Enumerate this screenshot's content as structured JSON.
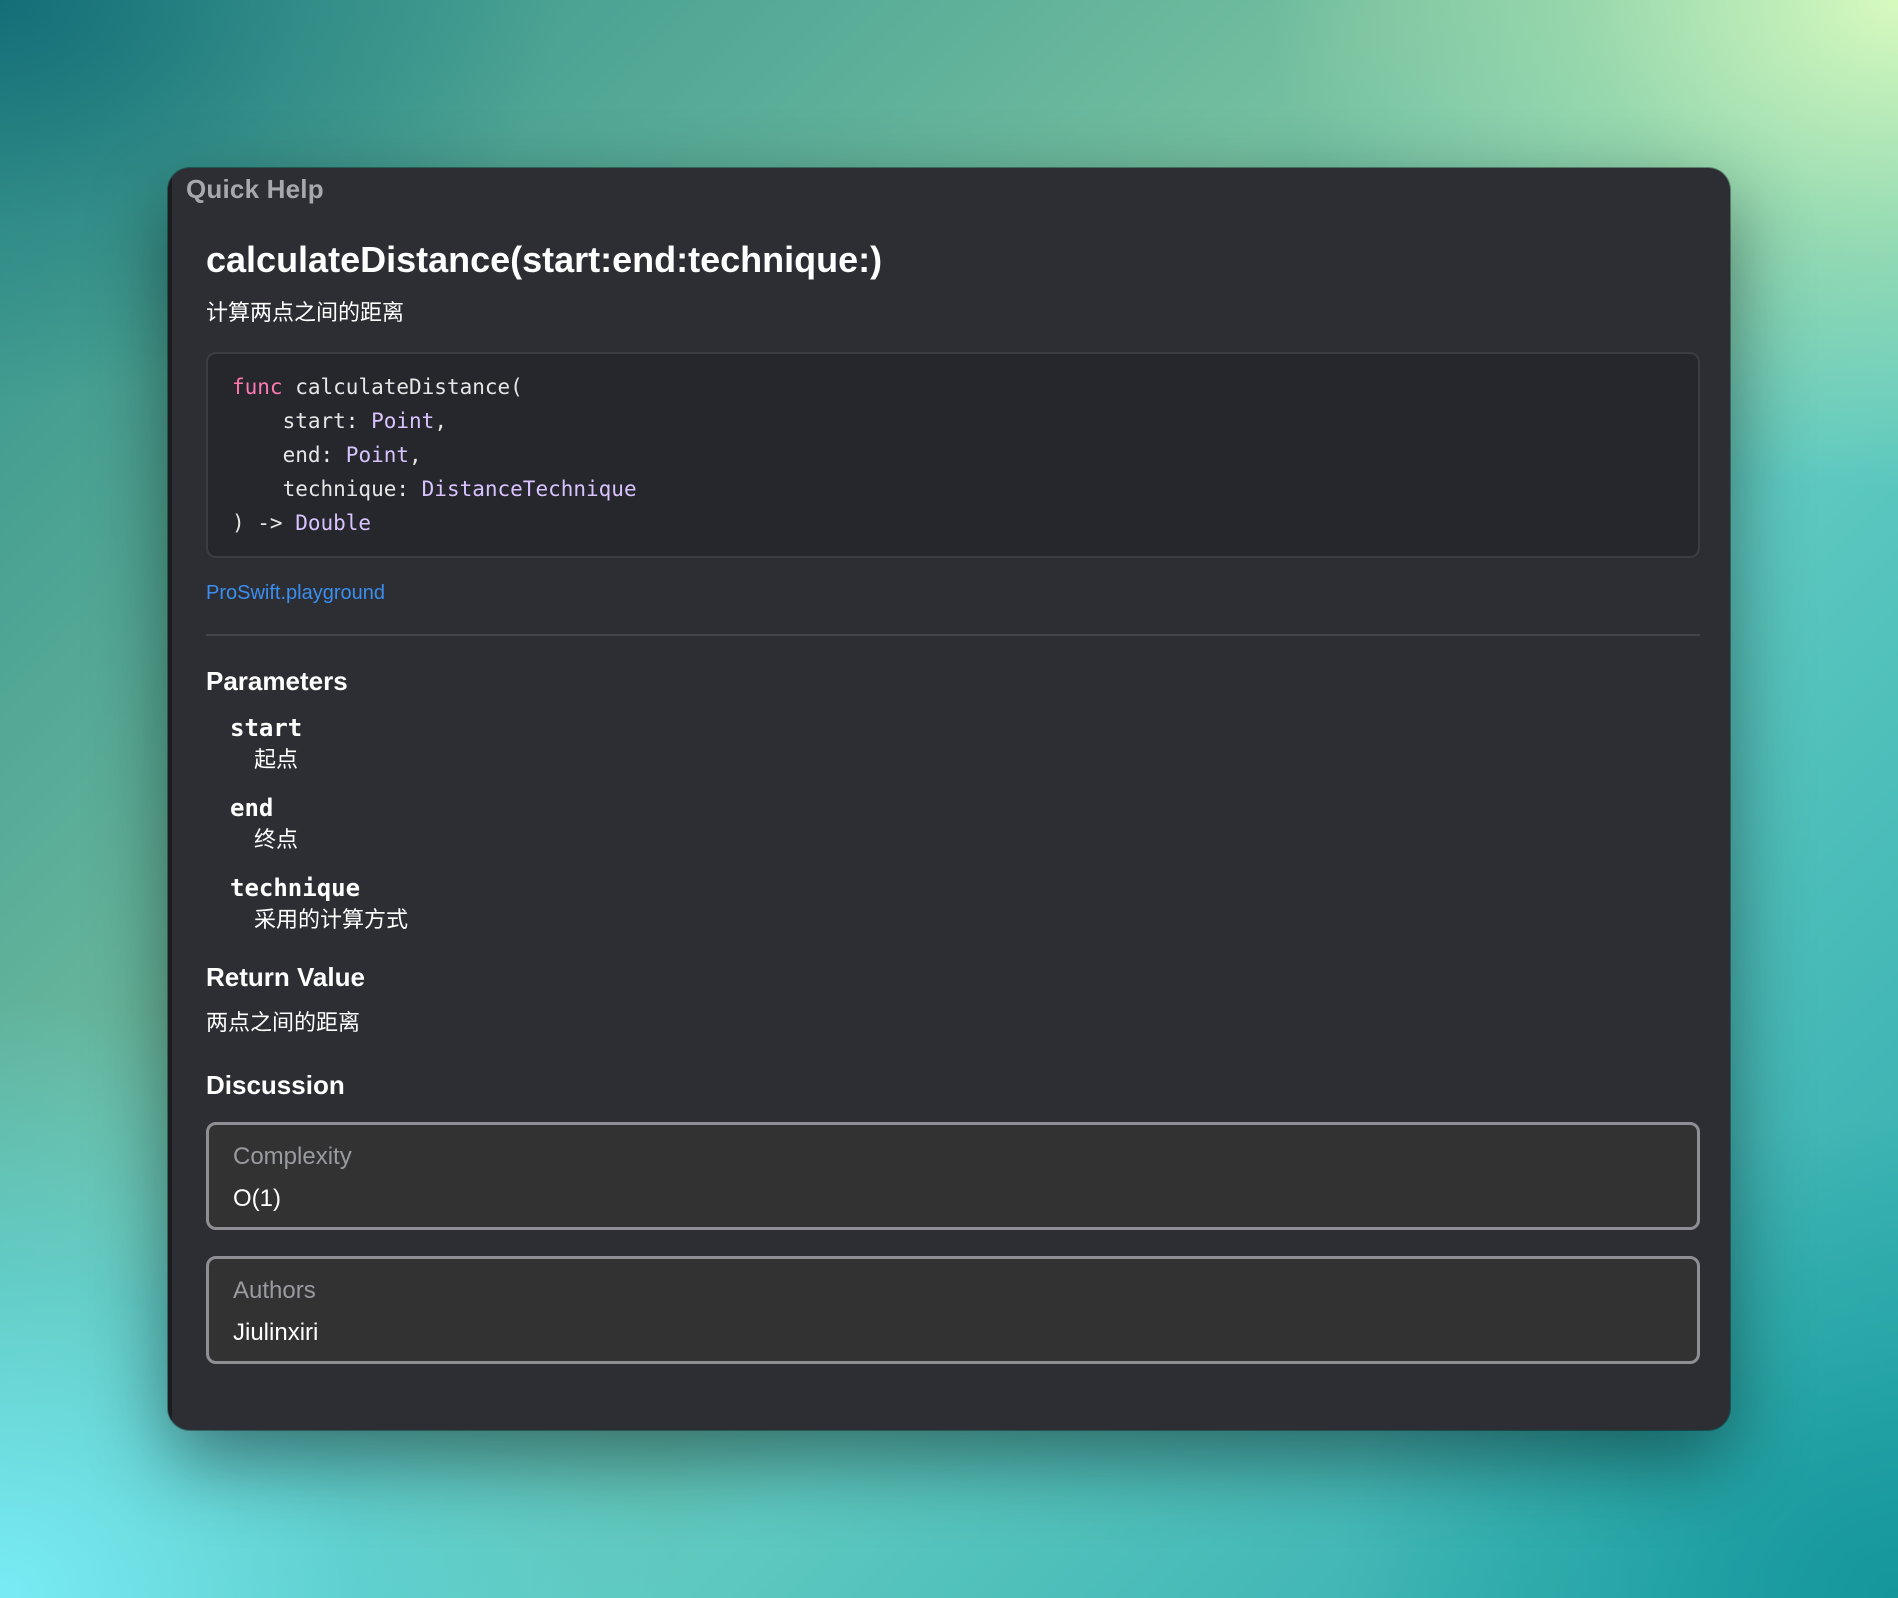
{
  "panel": {
    "title": "Quick Help"
  },
  "symbol": {
    "name": "calculateDistance(start:end:technique:)",
    "summary": "计算两点之间的距离"
  },
  "declaration": {
    "keyword": "func",
    "function_name": "calculateDistance(",
    "params": [
      {
        "label": "start: ",
        "type": "Point",
        "suffix": ","
      },
      {
        "label": "end: ",
        "type": "Point",
        "suffix": ","
      },
      {
        "label": "technique: ",
        "type": "DistanceTechnique",
        "suffix": ""
      }
    ],
    "return_arrow": ") -> ",
    "return_type": "Double"
  },
  "source_file": "ProSwift.playground",
  "parameters": {
    "heading": "Parameters",
    "items": [
      {
        "name": "start",
        "description": "起点"
      },
      {
        "name": "end",
        "description": "终点"
      },
      {
        "name": "technique",
        "description": "采用的计算方式"
      }
    ]
  },
  "return_value": {
    "heading": "Return Value",
    "description": "两点之间的距离"
  },
  "discussion": {
    "heading": "Discussion",
    "callouts": [
      {
        "label": "Complexity",
        "value": "O(1)"
      },
      {
        "label": "Authors",
        "value": "Jiulinxiri"
      }
    ]
  },
  "colors": {
    "panel_background": "#2d2e33",
    "keyword": "#ff7ab2",
    "type": "#d9c3ff",
    "link": "#3a8ef0"
  }
}
